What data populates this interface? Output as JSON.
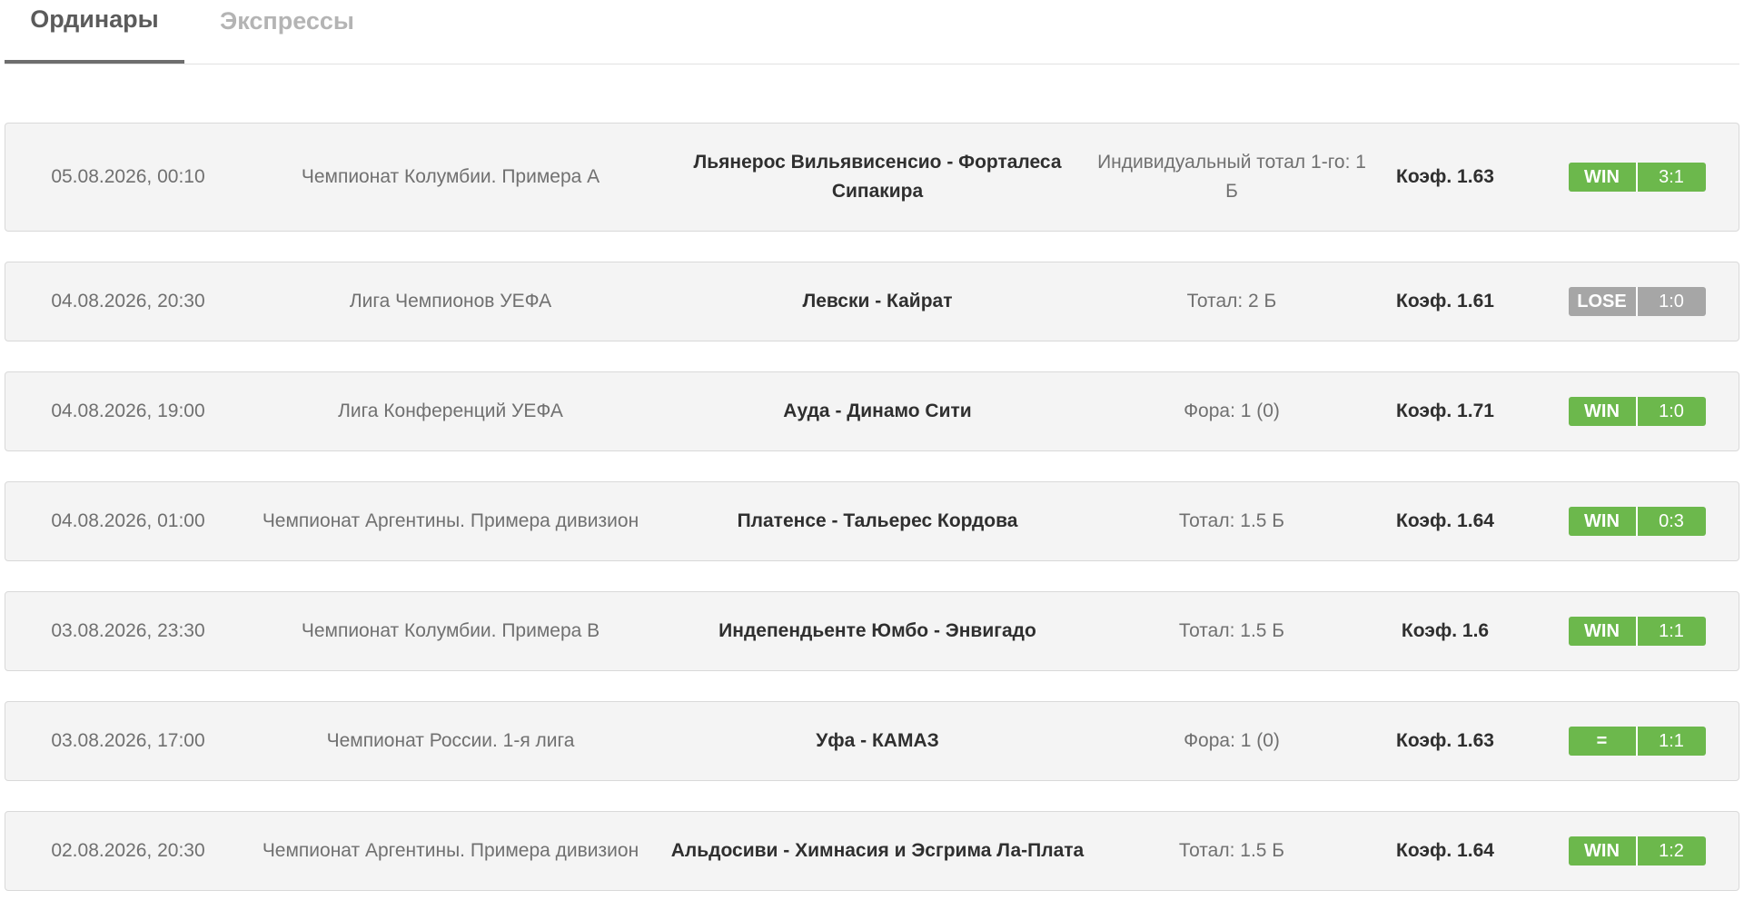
{
  "tabs": {
    "singles_label": "Ординары",
    "express_label": "Экспрессы"
  },
  "colors": {
    "win": "#6cb84c",
    "lose": "#a6a6a6"
  },
  "bets": [
    {
      "datetime": "05.08.2026, 00:10",
      "league": "Чемпионат Колумбии. Примера А",
      "match": "Льянерос Вильявисенсио - Форталеса Сипакира",
      "bet": "Индивидуальный тотал 1-го: 1 Б",
      "coef": "Коэф. 1.63",
      "status": "WIN",
      "score": "3:1"
    },
    {
      "datetime": "04.08.2026, 20:30",
      "league": "Лига Чемпионов УЕФА",
      "match": "Левски - Кайрат",
      "bet": "Тотал: 2 Б",
      "coef": "Коэф. 1.61",
      "status": "LOSE",
      "score": "1:0"
    },
    {
      "datetime": "04.08.2026, 19:00",
      "league": "Лига Конференций УЕФА",
      "match": "Ауда - Динамо Сити",
      "bet": "Фора: 1 (0)",
      "coef": "Коэф. 1.71",
      "status": "WIN",
      "score": "1:0"
    },
    {
      "datetime": "04.08.2026, 01:00",
      "league": "Чемпионат Аргентины. Примера дивизион",
      "match": "Платенсе - Тальерес Кордова",
      "bet": "Тотал: 1.5 Б",
      "coef": "Коэф. 1.64",
      "status": "WIN",
      "score": "0:3"
    },
    {
      "datetime": "03.08.2026, 23:30",
      "league": "Чемпионат Колумбии. Примера B",
      "match": "Индепендьенте Юмбо - Энвигадо",
      "bet": "Тотал: 1.5 Б",
      "coef": "Коэф. 1.6",
      "status": "WIN",
      "score": "1:1"
    },
    {
      "datetime": "03.08.2026, 17:00",
      "league": "Чемпионат России. 1-я лига",
      "match": "Уфа - КАМАЗ",
      "bet": "Фора: 1 (0)",
      "coef": "Коэф. 1.63",
      "status": "=",
      "score": "1:1"
    },
    {
      "datetime": "02.08.2026, 20:30",
      "league": "Чемпионат Аргентины. Примера дивизион",
      "match": "Альдосиви - Химнасия и Эсгрима Ла-Плата",
      "bet": "Тотал: 1.5 Б",
      "coef": "Коэф. 1.64",
      "status": "WIN",
      "score": "1:2"
    }
  ]
}
